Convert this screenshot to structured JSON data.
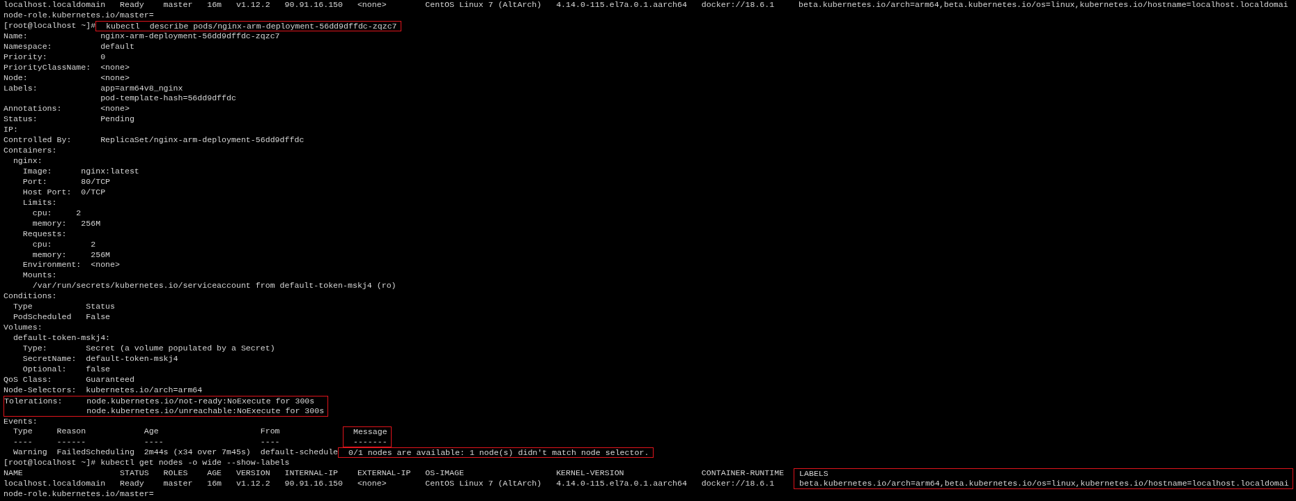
{
  "terminal": {
    "lines": [
      {
        "segments": [
          {
            "text": "localhost.localdomain   Ready    master   16m   v1.12.2   90.91.16.150   <none>        CentOS Linux 7 (AltArch)   4.14.0-115.el7a.0.1.aarch64   docker://18.6.1     beta.kubernetes.io/arch=arm64,beta.kubernetes.io/os=linux,kubernetes.io/hostname=localhost.localdomai",
            "boxed": false
          }
        ]
      },
      {
        "segments": [
          {
            "text": "node-role.kubernetes.io/master=",
            "boxed": false
          }
        ]
      },
      {
        "segments": [
          {
            "text": "[root@localhost ~]#",
            "boxed": false
          },
          {
            "text": "  kubectl  describe pods/nginx-arm-deployment-56dd9dffdc-zqzc7",
            "boxed": true
          }
        ]
      },
      {
        "segments": [
          {
            "text": "Name:               nginx-arm-deployment-56dd9dffdc-zqzc7",
            "boxed": false
          }
        ]
      },
      {
        "segments": [
          {
            "text": "Namespace:          default",
            "boxed": false
          }
        ]
      },
      {
        "segments": [
          {
            "text": "Priority:           0",
            "boxed": false
          }
        ]
      },
      {
        "segments": [
          {
            "text": "PriorityClassName:  <none>",
            "boxed": false
          }
        ]
      },
      {
        "segments": [
          {
            "text": "Node:               <none>",
            "boxed": false
          }
        ]
      },
      {
        "segments": [
          {
            "text": "Labels:             app=arm64v8_nginx",
            "boxed": false
          }
        ]
      },
      {
        "segments": [
          {
            "text": "                    pod-template-hash=56dd9dffdc",
            "boxed": false
          }
        ]
      },
      {
        "segments": [
          {
            "text": "Annotations:        <none>",
            "boxed": false
          }
        ]
      },
      {
        "segments": [
          {
            "text": "Status:             Pending",
            "boxed": false
          }
        ]
      },
      {
        "segments": [
          {
            "text": "IP:",
            "boxed": false
          }
        ]
      },
      {
        "segments": [
          {
            "text": "Controlled By:      ReplicaSet/nginx-arm-deployment-56dd9dffdc",
            "boxed": false
          }
        ]
      },
      {
        "segments": [
          {
            "text": "Containers:",
            "boxed": false
          }
        ]
      },
      {
        "segments": [
          {
            "text": "  nginx:",
            "boxed": false
          }
        ]
      },
      {
        "segments": [
          {
            "text": "    Image:      nginx:latest",
            "boxed": false
          }
        ]
      },
      {
        "segments": [
          {
            "text": "    Port:       80/TCP",
            "boxed": false
          }
        ]
      },
      {
        "segments": [
          {
            "text": "    Host Port:  0/TCP",
            "boxed": false
          }
        ]
      },
      {
        "segments": [
          {
            "text": "    Limits:",
            "boxed": false
          }
        ]
      },
      {
        "segments": [
          {
            "text": "      cpu:     2",
            "boxed": false
          }
        ]
      },
      {
        "segments": [
          {
            "text": "      memory:   256M",
            "boxed": false
          }
        ]
      },
      {
        "segments": [
          {
            "text": "    Requests:",
            "boxed": false
          }
        ]
      },
      {
        "segments": [
          {
            "text": "      cpu:        2",
            "boxed": false
          }
        ]
      },
      {
        "segments": [
          {
            "text": "      memory:     256M",
            "boxed": false
          }
        ]
      },
      {
        "segments": [
          {
            "text": "    Environment:  <none>",
            "boxed": false
          }
        ]
      },
      {
        "segments": [
          {
            "text": "    Mounts:",
            "boxed": false
          }
        ]
      },
      {
        "segments": [
          {
            "text": "      /var/run/secrets/kubernetes.io/serviceaccount from default-token-mskj4 (ro)",
            "boxed": false
          }
        ]
      },
      {
        "segments": [
          {
            "text": "Conditions:",
            "boxed": false
          }
        ]
      },
      {
        "segments": [
          {
            "text": "  Type           Status",
            "boxed": false
          }
        ]
      },
      {
        "segments": [
          {
            "text": "  PodScheduled   False",
            "boxed": false
          }
        ]
      },
      {
        "segments": [
          {
            "text": "Volumes:",
            "boxed": false
          }
        ]
      },
      {
        "segments": [
          {
            "text": "  default-token-mskj4:",
            "boxed": false
          }
        ]
      },
      {
        "segments": [
          {
            "text": "    Type:        Secret (a volume populated by a Secret)",
            "boxed": false
          }
        ]
      },
      {
        "segments": [
          {
            "text": "    SecretName:  default-token-mskj4",
            "boxed": false
          }
        ]
      },
      {
        "segments": [
          {
            "text": "    Optional:    false",
            "boxed": false
          }
        ]
      },
      {
        "segments": [
          {
            "text": "QoS Class:       Guaranteed",
            "boxed": false
          }
        ]
      },
      {
        "segments": [
          {
            "text": "Node-Selectors:  kubernetes.io/arch=arm64",
            "boxed": false
          }
        ]
      },
      {
        "segments": [
          {
            "text": "Tolerations:     node.kubernetes.io/not-ready:NoExecute for 300s",
            "boxed": true
          }
        ]
      },
      {
        "segments": [
          {
            "text": "                 node.kubernetes.io/unreachable:NoExecute for 300s",
            "boxed": true
          }
        ]
      },
      {
        "segments": [
          {
            "text": "Events:",
            "boxed": false
          }
        ]
      },
      {
        "segments": [
          {
            "text": "  Type     Reason            Age                     From             ",
            "boxed": false
          },
          {
            "text": "  Message",
            "boxed": true
          }
        ]
      },
      {
        "segments": [
          {
            "text": "  ----     ------            ----                    ----             ",
            "boxed": false
          },
          {
            "text": "  -------",
            "boxed": true
          }
        ]
      },
      {
        "segments": [
          {
            "text": "  Warning  FailedScheduling  2m44s (x34 over 7m45s)  default-schedule",
            "boxed": false
          },
          {
            "text": "  0/1 nodes are available: 1 node(s) didn't match node selector.",
            "boxed": true
          }
        ]
      },
      {
        "segments": [
          {
            "text": "[root@localhost ~]# kubectl get nodes -o wide --show-labels",
            "boxed": false
          }
        ]
      },
      {
        "segments": [
          {
            "text": "NAME                    STATUS   ROLES    AGE   VERSION   INTERNAL-IP    EXTERNAL-IP   OS-IMAGE                   KERNEL-VERSION                CONTAINER-RUNTIME  ",
            "boxed": false
          },
          {
            "text": " LABELS",
            "boxed": true
          }
        ]
      },
      {
        "segments": [
          {
            "text": "localhost.localdomain   Ready    master   16m   v1.12.2   90.91.16.150   <none>        CentOS Linux 7 (AltArch)   4.14.0-115.el7a.0.1.aarch64   docker://18.6.1    ",
            "boxed": false
          },
          {
            "text": " beta.kubernetes.io/arch=arm64,beta.kubernetes.io/os=linux,kubernetes.io/hostname=localhost.localdomai",
            "boxed": true
          }
        ]
      },
      {
        "segments": [
          {
            "text": "node-role.kubernetes.io/master=",
            "boxed": false
          }
        ]
      }
    ]
  }
}
